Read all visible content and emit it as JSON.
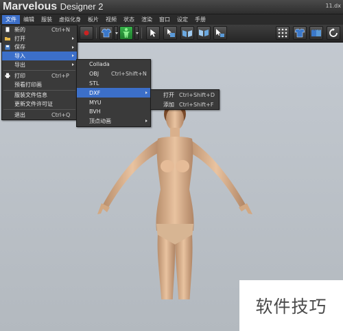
{
  "window": {
    "app_name": "Marvelous",
    "app_subtitle": "Designer 2",
    "file_name": "11.dx"
  },
  "menubar": [
    {
      "label": "文件",
      "active": true
    },
    {
      "label": "编辑"
    },
    {
      "label": "服装"
    },
    {
      "label": "虚拟化身"
    },
    {
      "label": "板片"
    },
    {
      "label": "视频"
    },
    {
      "label": "状态"
    },
    {
      "label": "渲染"
    },
    {
      "label": "窗口"
    },
    {
      "label": "设定"
    },
    {
      "label": "手册"
    }
  ],
  "file_menu": {
    "items": [
      {
        "label": "新的",
        "shortcut": "Ctrl+N",
        "icon": "new-file-icon"
      },
      {
        "label": "打开",
        "submenu": true,
        "icon": "open-folder-icon"
      },
      {
        "label": "保存",
        "submenu": true,
        "icon": "save-icon"
      },
      {
        "label": "导入",
        "submenu": true,
        "highlighted": true
      },
      {
        "label": "导出",
        "submenu": true
      },
      {
        "label": "打印",
        "shortcut": "Ctrl+P",
        "icon": "print-icon"
      },
      {
        "label": "预看打印画"
      },
      {
        "label": "服装文件信息"
      },
      {
        "label": "更新文件许可证"
      },
      {
        "label": "退出",
        "shortcut": "Ctrl+Q"
      }
    ]
  },
  "import_menu": {
    "items": [
      {
        "label": "Collada"
      },
      {
        "label": "OBJ",
        "shortcut": "Ctrl+Shift+N"
      },
      {
        "label": "STL"
      },
      {
        "label": "DXF",
        "submenu": true,
        "highlighted": true
      },
      {
        "label": "MYU"
      },
      {
        "label": "BVH"
      },
      {
        "label": "顶点动画",
        "submenu": true
      }
    ]
  },
  "dxf_menu": {
    "items": [
      {
        "label": "打开",
        "shortcut": "Ctrl+Shift+D"
      },
      {
        "label": "添加",
        "shortcut": "Ctrl+Shift+F"
      }
    ]
  },
  "watermark": {
    "text": "软件技巧"
  },
  "colors": {
    "menu_highlight": "#3c6fc9",
    "menu_bg": "#3a3a3a",
    "viewport_bg": "#c3c9d0"
  }
}
